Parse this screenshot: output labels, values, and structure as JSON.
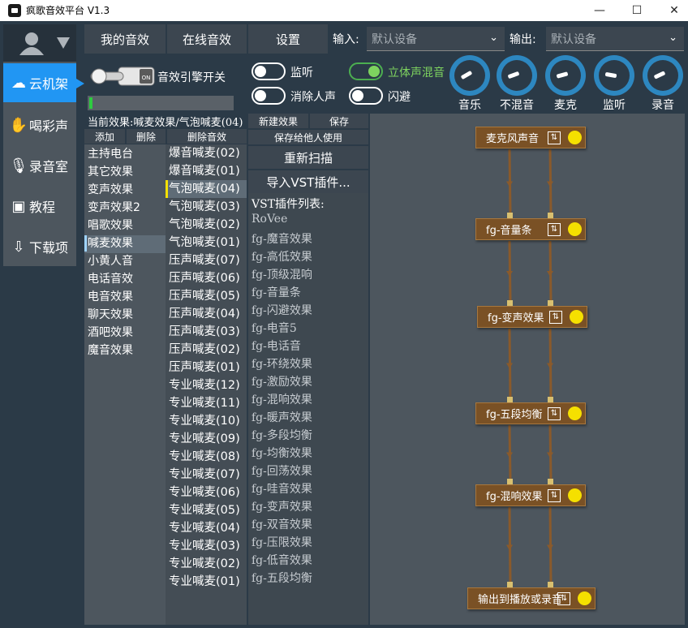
{
  "window": {
    "title": "疯歌音效平台 V1.3",
    "min": "—",
    "max": "☐",
    "close": "✕"
  },
  "nav": {
    "items": [
      {
        "label": "云机架",
        "icon": "cloud-icon",
        "glyph": "☁",
        "active": true
      },
      {
        "label": "喝彩声",
        "icon": "clap-icon",
        "glyph": "✋",
        "active": false
      },
      {
        "label": "录音室",
        "icon": "microphone-icon",
        "glyph": "🎙",
        "active": false
      },
      {
        "label": "教程",
        "icon": "teacher-icon",
        "glyph": "▣",
        "active": false
      },
      {
        "label": "下载项",
        "icon": "cloud-download-icon",
        "glyph": "⇩",
        "active": false
      }
    ]
  },
  "tabs": {
    "my_effects": "我的音效",
    "online_effects": "在线音效",
    "settings": "设置"
  },
  "io": {
    "input_label": "输入:",
    "input_value": "默认设备",
    "output_label": "输出:",
    "output_value": "默认设备"
  },
  "engine": {
    "label": "音效引擎开关",
    "switch_text": "ON"
  },
  "toggles": {
    "monitor": "监听",
    "stereo_mix": "立体声混音",
    "remove_vocal": "消除人声",
    "dodge": "闪避"
  },
  "knobs": [
    "音乐",
    "不混音",
    "麦克",
    "监听",
    "录音"
  ],
  "current_effect": "当前效果:喊麦效果/气泡喊麦(04)",
  "category_buttons": {
    "add": "添加",
    "delete": "删除",
    "delete_effect": "删除音效"
  },
  "categories": [
    "主持电台",
    "其它效果",
    "变声效果",
    "变声效果2",
    "唱歌效果",
    "喊麦效果",
    "小黄人音",
    "电话音效",
    "电音效果",
    "聊天效果",
    "酒吧效果",
    "魔音效果"
  ],
  "selected_category": 5,
  "effects": [
    "爆音喊麦(02)",
    "爆音喊麦(01)",
    "气泡喊麦(04)",
    "气泡喊麦(03)",
    "气泡喊麦(02)",
    "气泡喊麦(01)",
    "压声喊麦(07)",
    "压声喊麦(06)",
    "压声喊麦(05)",
    "压声喊麦(04)",
    "压声喊麦(03)",
    "压声喊麦(02)",
    "压声喊麦(01)",
    "专业喊麦(12)",
    "专业喊麦(11)",
    "专业喊麦(10)",
    "专业喊麦(09)",
    "专业喊麦(08)",
    "专业喊麦(07)",
    "专业喊麦(06)",
    "专业喊麦(05)",
    "专业喊麦(04)",
    "专业喊麦(03)",
    "专业喊麦(02)",
    "专业喊麦(01)"
  ],
  "selected_effect": 2,
  "plugin_buttons": {
    "new_effect": "新建效果",
    "save": "保存",
    "save_for_others": "保存给他人使用",
    "rescan": "重新扫描",
    "import_vst": "导入VST插件..."
  },
  "vst": {
    "header": "VST插件列表:",
    "items": [
      "RoVee",
      "fg-魔音效果",
      "fg-高低效果",
      "fg-顶级混响",
      "fg-音量条",
      "fg-闪避效果",
      "fg-电音5",
      "fg-电话音",
      "fg-环绕效果",
      "fg-激励效果",
      "fg-混响效果",
      "fg-暖声效果",
      "fg-多段均衡",
      "fg-均衡效果",
      "fg-回荡效果",
      "fg-哇音效果",
      "fg-变声效果",
      "fg-双音效果",
      "fg-压限效果",
      "fg-低音效果",
      "fg-五段均衡"
    ]
  },
  "chain": {
    "nodes": [
      "麦克风声音",
      "fg-音量条",
      "fg-变声效果",
      "fg-五段均衡",
      "fg-混响效果",
      "输出到播放或录音"
    ],
    "settings_glyph": "⇅"
  },
  "colors": {
    "accent": "#2196f3",
    "node": "#7a5125",
    "node_dot": "#f5e000",
    "level_meter": "#2ecc40"
  }
}
